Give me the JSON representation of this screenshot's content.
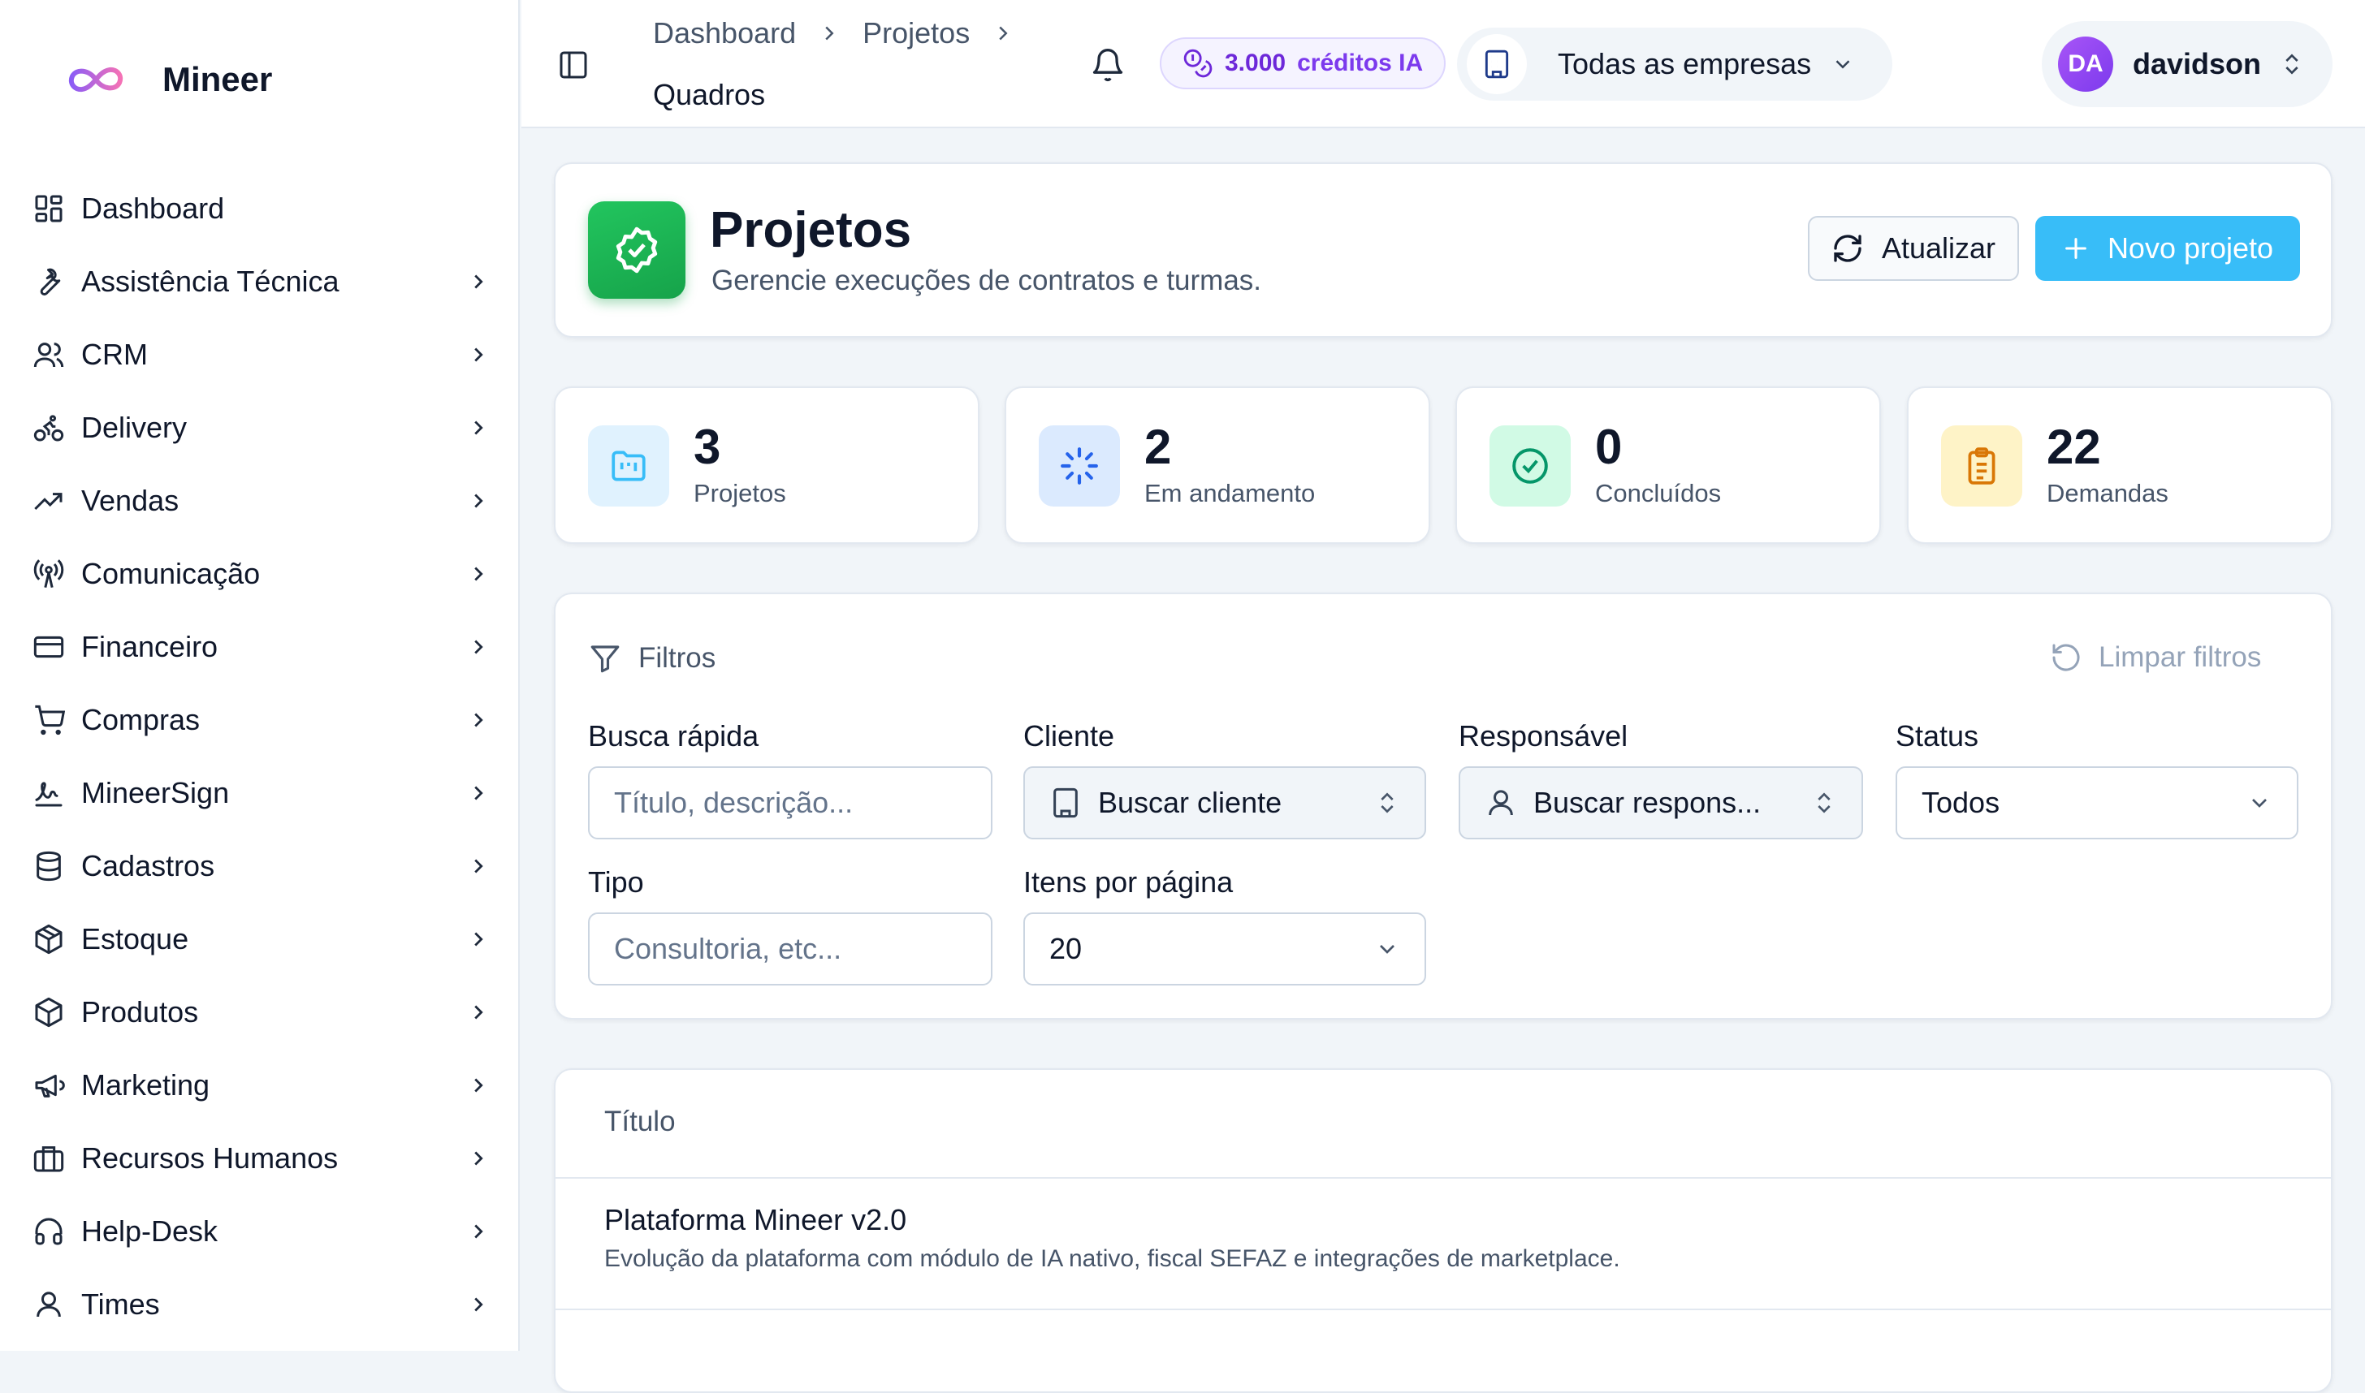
{
  "brand": {
    "name": "Mineer"
  },
  "sidebar": {
    "items": [
      {
        "label": "Dashboard",
        "icon": "dashboard-icon",
        "expandable": false
      },
      {
        "label": "Assistência Técnica",
        "icon": "wrench-icon",
        "expandable": true
      },
      {
        "label": "CRM",
        "icon": "users-icon",
        "expandable": true
      },
      {
        "label": "Delivery",
        "icon": "bike-icon",
        "expandable": true
      },
      {
        "label": "Vendas",
        "icon": "trending-up-icon",
        "expandable": true
      },
      {
        "label": "Comunicação",
        "icon": "radio-tower-icon",
        "expandable": true
      },
      {
        "label": "Financeiro",
        "icon": "credit-card-icon",
        "expandable": true
      },
      {
        "label": "Compras",
        "icon": "cart-icon",
        "expandable": true
      },
      {
        "label": "MineerSign",
        "icon": "signature-icon",
        "expandable": true
      },
      {
        "label": "Cadastros",
        "icon": "database-icon",
        "expandable": true
      },
      {
        "label": "Estoque",
        "icon": "package-icon",
        "expandable": true
      },
      {
        "label": "Produtos",
        "icon": "box-icon",
        "expandable": true
      },
      {
        "label": "Marketing",
        "icon": "megaphone-icon",
        "expandable": true
      },
      {
        "label": "Recursos Humanos",
        "icon": "briefcase-icon",
        "expandable": true
      },
      {
        "label": "Help-Desk",
        "icon": "headphones-icon",
        "expandable": true
      },
      {
        "label": "Times",
        "icon": "user-icon",
        "expandable": true
      }
    ]
  },
  "topbar": {
    "breadcrumb": [
      "Dashboard",
      "Projetos",
      "Quadros"
    ],
    "credits": {
      "value": "3.000",
      "label": "créditos IA"
    },
    "company": "Todas as empresas",
    "user": {
      "initials": "DA",
      "name": "davidson"
    }
  },
  "header": {
    "title": "Projetos",
    "subtitle": "Gerencie execuções de contratos e turmas.",
    "refresh_label": "Atualizar",
    "new_label": "Novo projeto"
  },
  "stats": [
    {
      "value": "3",
      "label": "Projetos",
      "icon": "folder-icon",
      "color": "#38bdf8",
      "bg": "#e0f2fe"
    },
    {
      "value": "2",
      "label": "Em andamento",
      "icon": "loader-icon",
      "color": "#2563eb",
      "bg": "#dbeafe"
    },
    {
      "value": "0",
      "label": "Concluídos",
      "icon": "check-circle-icon",
      "color": "#059669",
      "bg": "#d1fae5"
    },
    {
      "value": "22",
      "label": "Demandas",
      "icon": "clipboard-icon",
      "color": "#d97706",
      "bg": "#fef3c7"
    }
  ],
  "filters": {
    "title": "Filtros",
    "clear_label": "Limpar filtros",
    "search": {
      "label": "Busca rápida",
      "placeholder": "Título, descrição..."
    },
    "client": {
      "label": "Cliente",
      "value": "Buscar cliente"
    },
    "owner": {
      "label": "Responsável",
      "value": "Buscar respons..."
    },
    "status": {
      "label": "Status",
      "value": "Todos"
    },
    "type": {
      "label": "Tipo",
      "placeholder": "Consultoria, etc..."
    },
    "per_page": {
      "label": "Itens por página",
      "value": "20"
    }
  },
  "table": {
    "columns": [
      "Título"
    ],
    "rows": [
      {
        "title": "Plataforma Mineer v2.0",
        "description": "Evolução da plataforma com módulo de IA nativo, fiscal SEFAZ e integrações de marketplace."
      }
    ]
  }
}
